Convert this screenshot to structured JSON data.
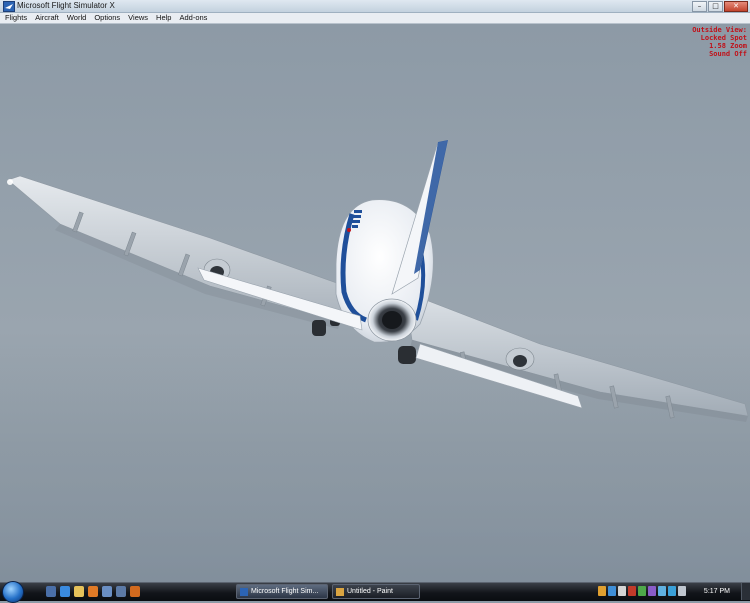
{
  "window": {
    "title": "Microsoft Flight Simulator X",
    "controls": {
      "minimize": "–",
      "maximize": "□",
      "close": "✕"
    }
  },
  "menu": {
    "items": [
      "Flights",
      "Aircraft",
      "World",
      "Options",
      "Views",
      "Help",
      "Add-ons"
    ]
  },
  "view_info": {
    "line1": "Outside View:",
    "line2": "Locked Spot",
    "line3": "1.58 Zoom",
    "line4": "Sound Off"
  },
  "scene": {
    "subject": "airliner-rear-view",
    "sky_color": "#95a1ac",
    "sea_color": "#8693a0",
    "fuselage_color": "#f2f4f8",
    "stripe_color": "#1f4f9a"
  },
  "taskbar": {
    "tasks": [
      {
        "label": "Microsoft Flight Sim...",
        "icon": "fsx-icon",
        "active": true
      },
      {
        "label": "Untitled - Paint",
        "icon": "paint-icon",
        "active": false
      }
    ],
    "clock": "5:17 PM"
  },
  "icons": {
    "start": "windows-start-orb-icon",
    "quicklaunch": [
      "show-desktop-icon",
      "internet-explorer-icon",
      "firefox-icon",
      "folder-icon",
      "media-icon",
      "switch-windows-icon",
      "firefox-icon"
    ],
    "tray": [
      "network-icon",
      "security-icon",
      "volume-icon",
      "antivirus-icon",
      "update-icon",
      "language-icon",
      "battery-icon",
      "messenger-icon",
      "speaker-icon"
    ]
  }
}
